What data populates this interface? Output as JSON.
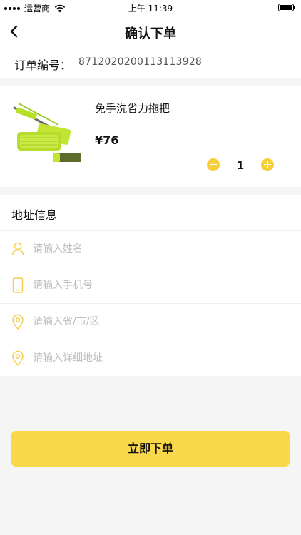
{
  "status_bar": {
    "carrier": "运营商",
    "time": "上午 11:39"
  },
  "nav": {
    "title": "确认下单",
    "back_icon": "chevron-left-icon"
  },
  "order": {
    "label": "订单编号：",
    "number": "8712020200113113928"
  },
  "product": {
    "name": "免手洗省力拖把",
    "price": "¥76",
    "quantity": "1",
    "image": "mop-image"
  },
  "address": {
    "title": "地址信息",
    "fields": [
      {
        "placeholder": "请输入姓名",
        "icon": "person-icon"
      },
      {
        "placeholder": "请输入手机号",
        "icon": "phone-icon"
      },
      {
        "placeholder": "请输入省/市/区",
        "icon": "location-pin-icon"
      },
      {
        "placeholder": "请输入详细地址",
        "icon": "location-pin-icon"
      }
    ]
  },
  "submit": {
    "label": "立即下单"
  },
  "colors": {
    "accent": "#f9d849",
    "icon_yellow": "#f7cf3a"
  }
}
